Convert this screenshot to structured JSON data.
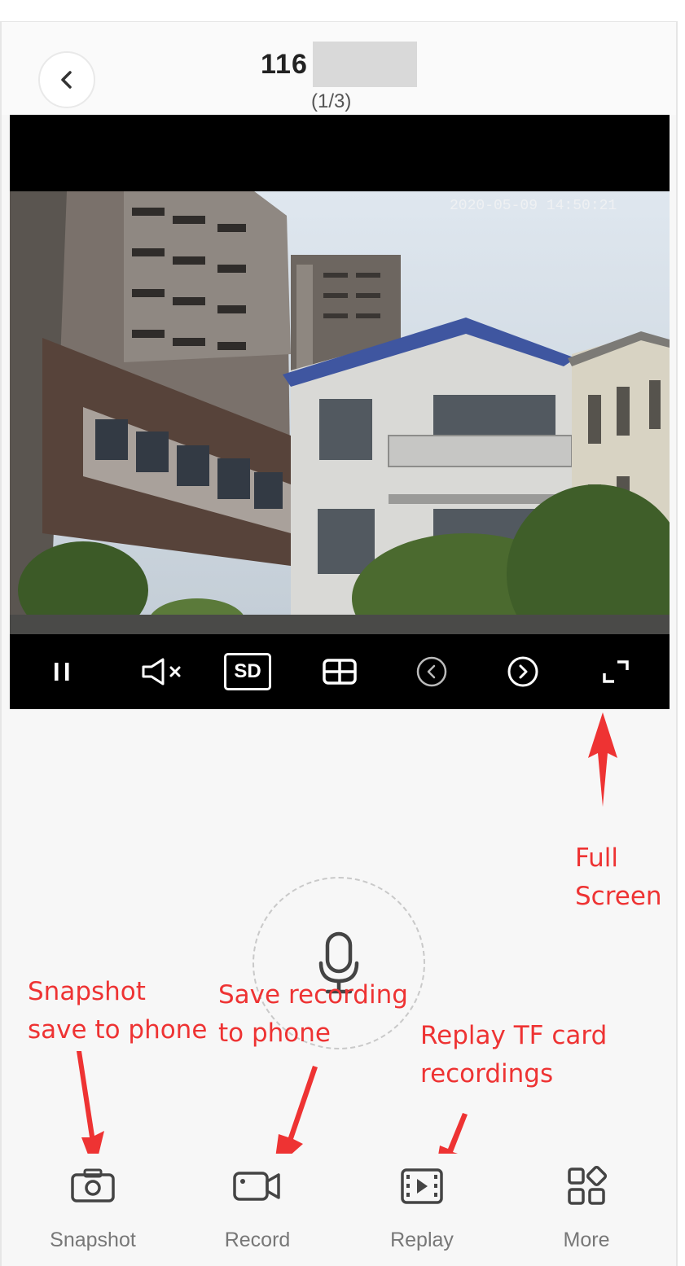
{
  "header": {
    "back_icon": "chevron-left-icon",
    "title": "116",
    "subtitle": "(1/3)"
  },
  "video": {
    "timestamp_text": "2020-05-09 14:50:21",
    "controls": [
      {
        "name": "pause",
        "icon": "pause-icon"
      },
      {
        "name": "mute",
        "icon": "speaker-muted-icon"
      },
      {
        "name": "quality",
        "icon": "sd-quality-icon",
        "label": "SD"
      },
      {
        "name": "split",
        "icon": "split-view-icon"
      },
      {
        "name": "previous",
        "icon": "chevron-left-circle-icon"
      },
      {
        "name": "next",
        "icon": "chevron-right-circle-icon"
      },
      {
        "name": "fullscreen",
        "icon": "fullscreen-icon"
      }
    ]
  },
  "talk": {
    "icon": "microphone-icon"
  },
  "toolbar": {
    "items": [
      {
        "label": "Snapshot",
        "icon": "camera-icon"
      },
      {
        "label": "Record",
        "icon": "video-camera-icon"
      },
      {
        "label": "Replay",
        "icon": "film-play-icon"
      },
      {
        "label": "More",
        "icon": "grid-more-icon"
      }
    ]
  },
  "annotations": {
    "fullscreen_line1": "Full",
    "fullscreen_line2": "Screen",
    "snapshot_line1": "Snapshot",
    "snapshot_line2": "save to phone",
    "record_line1": "Save recording",
    "record_line2": "to phone",
    "replay_line1": "Replay TF card",
    "replay_line2": "recordings",
    "color": "#ee3333"
  },
  "colors": {
    "background": "#f7f7f7",
    "video_bar": "#000000",
    "toolbar_label": "#777777"
  }
}
